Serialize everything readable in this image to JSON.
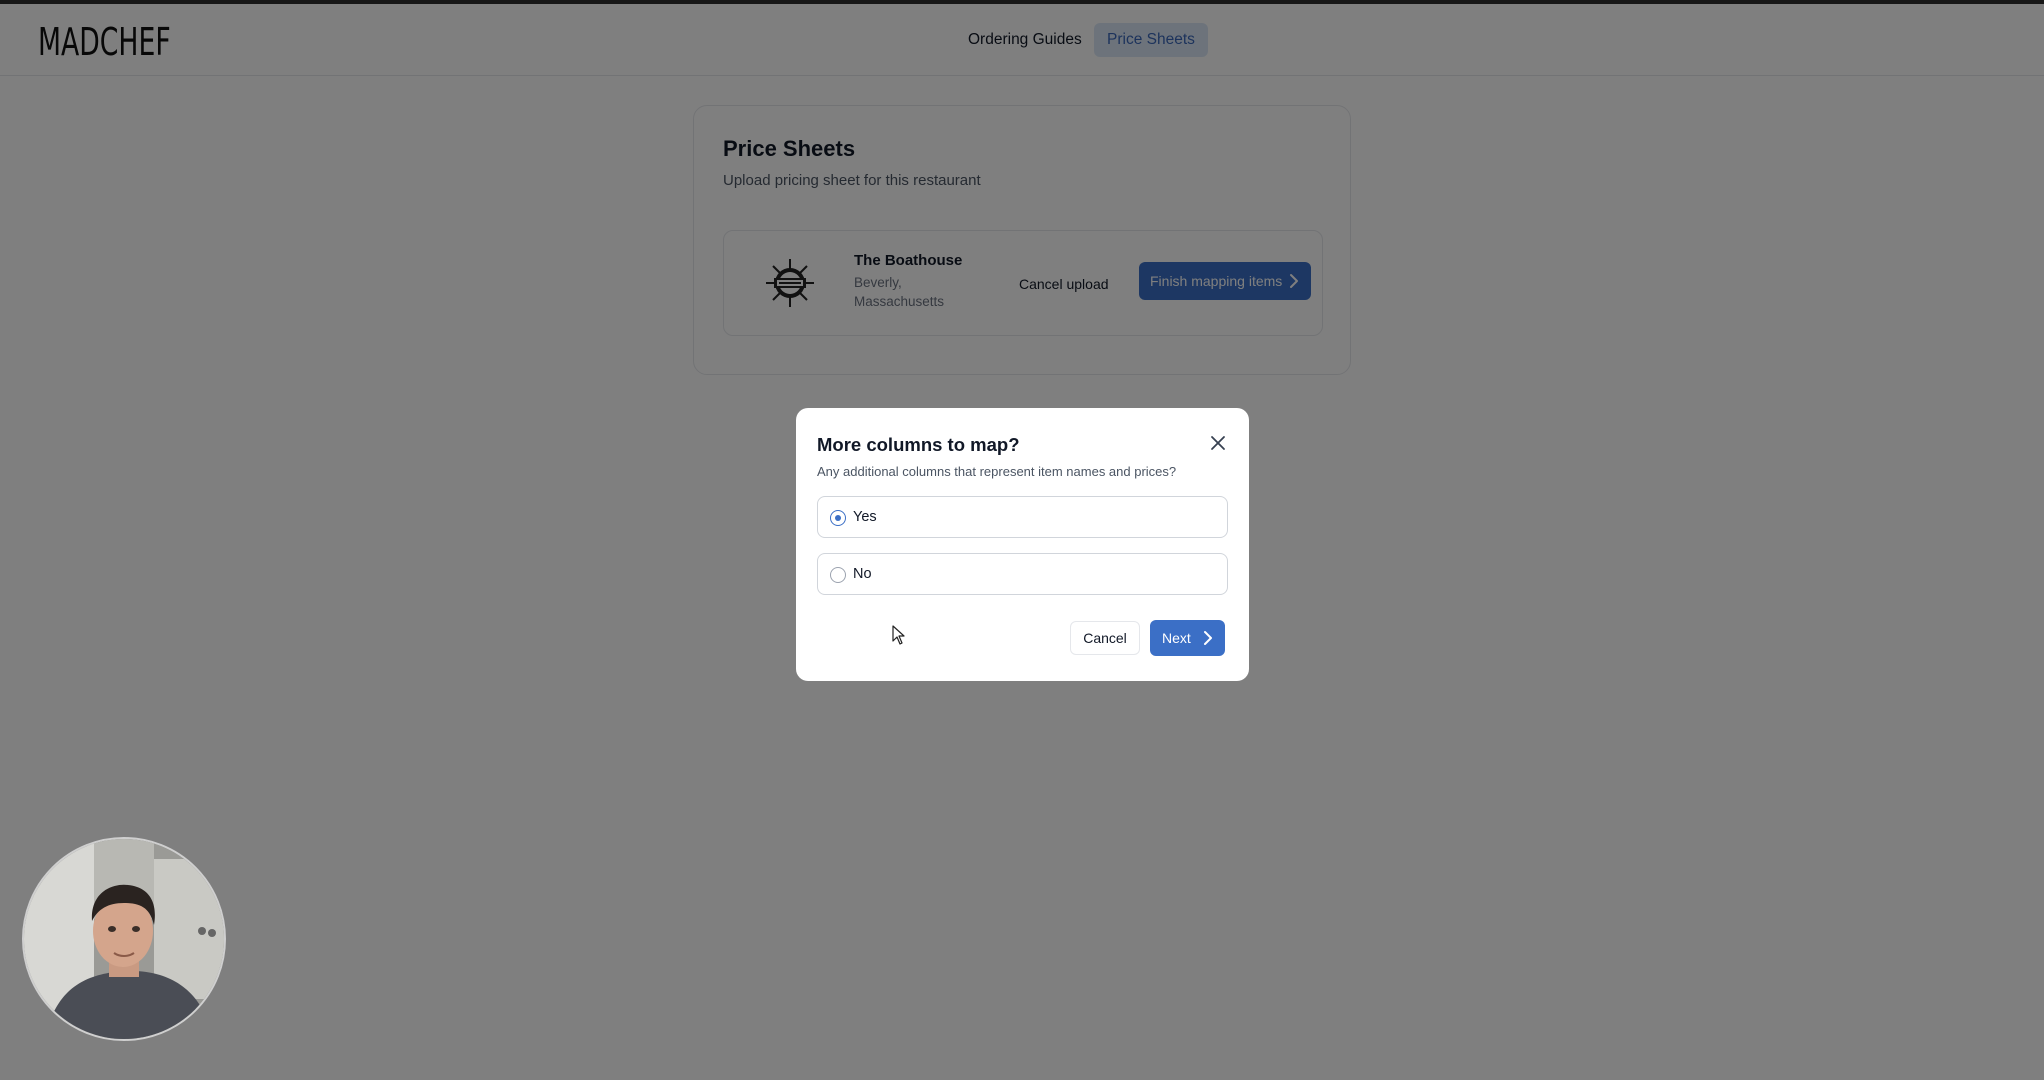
{
  "header": {
    "logo": "MADCHEF",
    "nav": [
      {
        "label": "Ordering Guides",
        "active": false
      },
      {
        "label": "Price Sheets",
        "active": true
      }
    ]
  },
  "price_sheets": {
    "title": "Price Sheets",
    "subtitle": "Upload pricing sheet for this restaurant",
    "restaurant": {
      "name": "The Boathouse",
      "location": "Beverly, Massachusetts"
    },
    "cancel_upload_label": "Cancel upload",
    "finish_label": "Finish mapping items"
  },
  "modal": {
    "title": "More columns to map?",
    "subtitle": "Any additional columns that represent item names and prices?",
    "options": [
      {
        "label": "Yes",
        "selected": true
      },
      {
        "label": "No",
        "selected": false
      }
    ],
    "cancel_label": "Cancel",
    "next_label": "Next"
  },
  "colors": {
    "accent": "#3b6fc6",
    "nav_active_bg": "#dbe7f7",
    "overlay": "rgba(0,0,0,0.5)"
  },
  "icons": [
    "close-icon",
    "chevron-right-icon",
    "restaurant-logo",
    "mouse-cursor-icon",
    "webcam-feed"
  ]
}
